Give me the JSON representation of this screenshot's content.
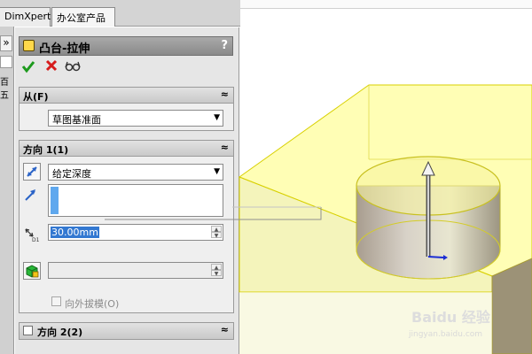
{
  "tabs": [
    {
      "label": "DimXpert"
    },
    {
      "label": "办公室产品"
    }
  ],
  "left_strip": {
    "expand_label": "»",
    "partial_text": "百五"
  },
  "feature": {
    "title": "凸台-拉伸",
    "help_label": "?"
  },
  "actions": {
    "ok_icon": "check-icon",
    "cancel_icon": "x-icon",
    "preview_icon": "glasses-icon"
  },
  "from_group": {
    "title": "从(F)",
    "collapse_label": "≈",
    "start_condition": "草图基准面"
  },
  "direction1": {
    "title": "方向 1(1)",
    "collapse_label": "≈",
    "end_condition": "给定深度",
    "depth_value": "30.00mm",
    "draft_label": "向外拔模(O)"
  },
  "direction2": {
    "title": "方向 2(2)",
    "collapse_label": "≈"
  },
  "watermark": {
    "brand": "Baidu 经验",
    "url": "jingyan.baidu.com"
  },
  "colors": {
    "accent_blue": "#3378d1",
    "selection_blue": "#5fa8ee",
    "ok_green": "#1d9a1d",
    "cancel_red": "#d61b1b",
    "preview_yellow": "#ffff66"
  }
}
